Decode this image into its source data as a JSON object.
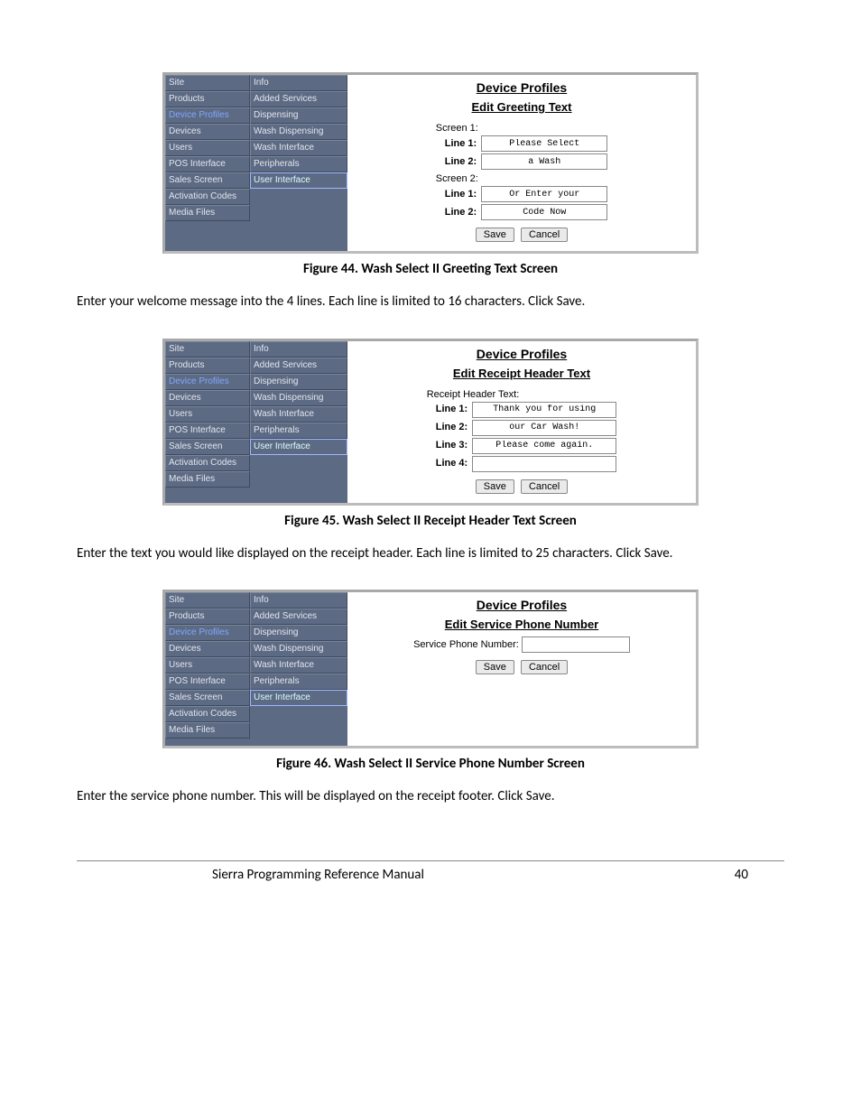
{
  "nav_items": [
    "Site",
    "Products",
    "Device Profiles",
    "Devices",
    "Users",
    "POS Interface",
    "Sales Screen",
    "Activation Codes",
    "Media Files"
  ],
  "nav_selected_index": 2,
  "sub_items": [
    "Info",
    "Added Services",
    "Dispensing",
    "Wash Dispensing",
    "Wash Interface",
    "Peripherals",
    "User Interface"
  ],
  "sub_selected_index": 6,
  "content_title": "Device Profiles",
  "btn_save": "Save",
  "btn_cancel": "Cancel",
  "fig44": {
    "subtitle": "Edit Greeting Text",
    "screen1_label": "Screen 1:",
    "screen2_label": "Screen 2:",
    "line1_label": "Line 1:",
    "line2_label": "Line 2:",
    "s1_l1": "Please Select",
    "s1_l2": "a Wash",
    "s2_l1": "Or Enter your",
    "s2_l2": "Code Now",
    "caption": "Figure 44. Wash Select II Greeting Text Screen",
    "body": "Enter your welcome message into the 4 lines. Each line is limited to 16 characters. Click Save."
  },
  "fig45": {
    "subtitle": "Edit Receipt Header Text",
    "header_label": "Receipt Header Text:",
    "line1_label": "Line 1:",
    "line2_label": "Line 2:",
    "line3_label": "Line 3:",
    "line4_label": "Line 4:",
    "l1": "Thank you for using",
    "l2": "our Car Wash!",
    "l3": "Please come again.",
    "l4": "",
    "caption": "Figure 45. Wash Select II Receipt Header Text Screen",
    "body": "Enter the text you would like displayed on the receipt header. Each line is limited to 25 characters. Click Save."
  },
  "fig46": {
    "subtitle": "Edit Service Phone Number",
    "label": "Service Phone Number:",
    "value": "",
    "caption": "Figure 46. Wash Select II Service Phone Number Screen",
    "body": "Enter the service phone number. This will be displayed on the receipt footer. Click Save."
  },
  "footer": {
    "title": "Sierra Programming Reference Manual",
    "page": "40"
  }
}
